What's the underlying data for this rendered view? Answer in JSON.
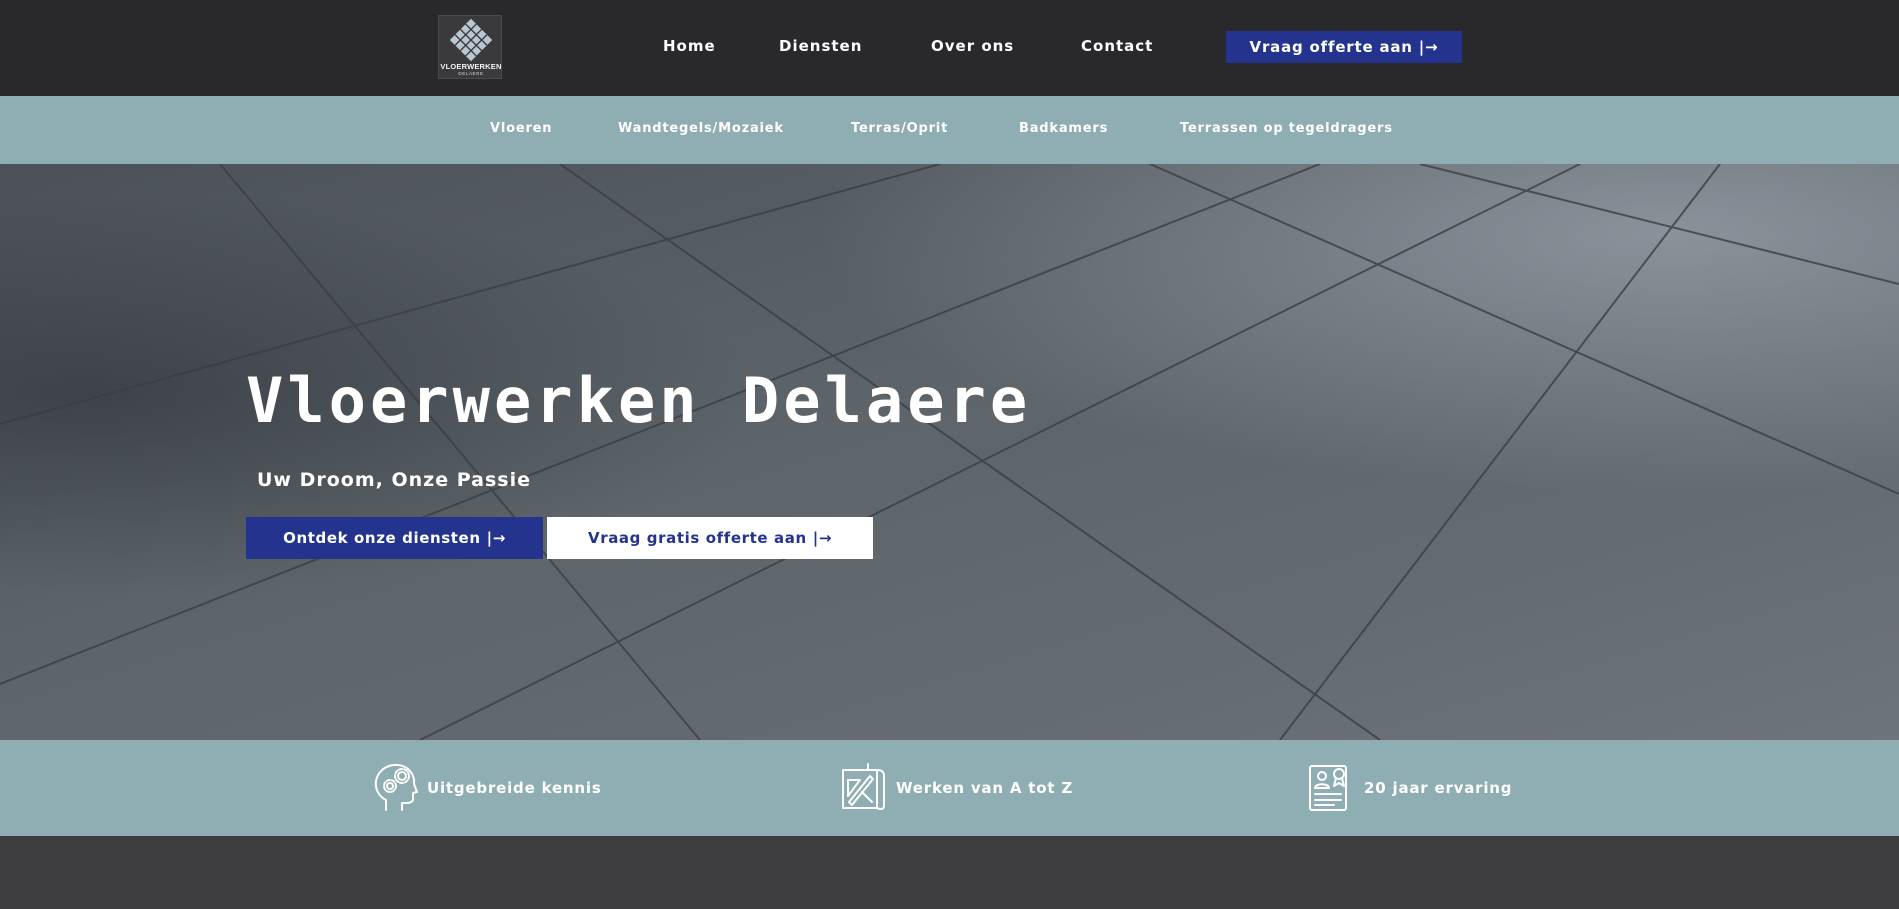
{
  "header": {
    "logo": {
      "name": "VLOERWERKEN",
      "sub": "DELAERE",
      "icon": "tile-diamond-logo"
    },
    "nav": [
      "Home",
      "Diensten",
      "Over ons",
      "Contact"
    ],
    "cta_label": "Vraag offerte aan",
    "cta_icon": "arrow-right-bar-icon"
  },
  "subnav": [
    "Vloeren",
    "Wandtegels/Mozaiek",
    "Terras/Oprit",
    "Badkamers",
    "Terrassen op tegeldragers"
  ],
  "hero": {
    "title": "Vloerwerken Delaere",
    "subtitle": "Uw Droom, Onze Passie",
    "primary_button": "Ontdek onze diensten",
    "secondary_button": "Vraag gratis offerte aan",
    "arrow": "|→"
  },
  "features": [
    {
      "icon": "head-gear-icon",
      "label": "Uitgebreide kennis"
    },
    {
      "icon": "blueprint-tools-icon",
      "label": "Werken van A tot Z"
    },
    {
      "icon": "certificate-icon",
      "label": "20 jaar ervaring"
    }
  ],
  "colors": {
    "header_bg": "#29292c",
    "subnav_bg": "#8faeb4",
    "accent": "#24348e",
    "page_bg": "#3e3e41"
  }
}
